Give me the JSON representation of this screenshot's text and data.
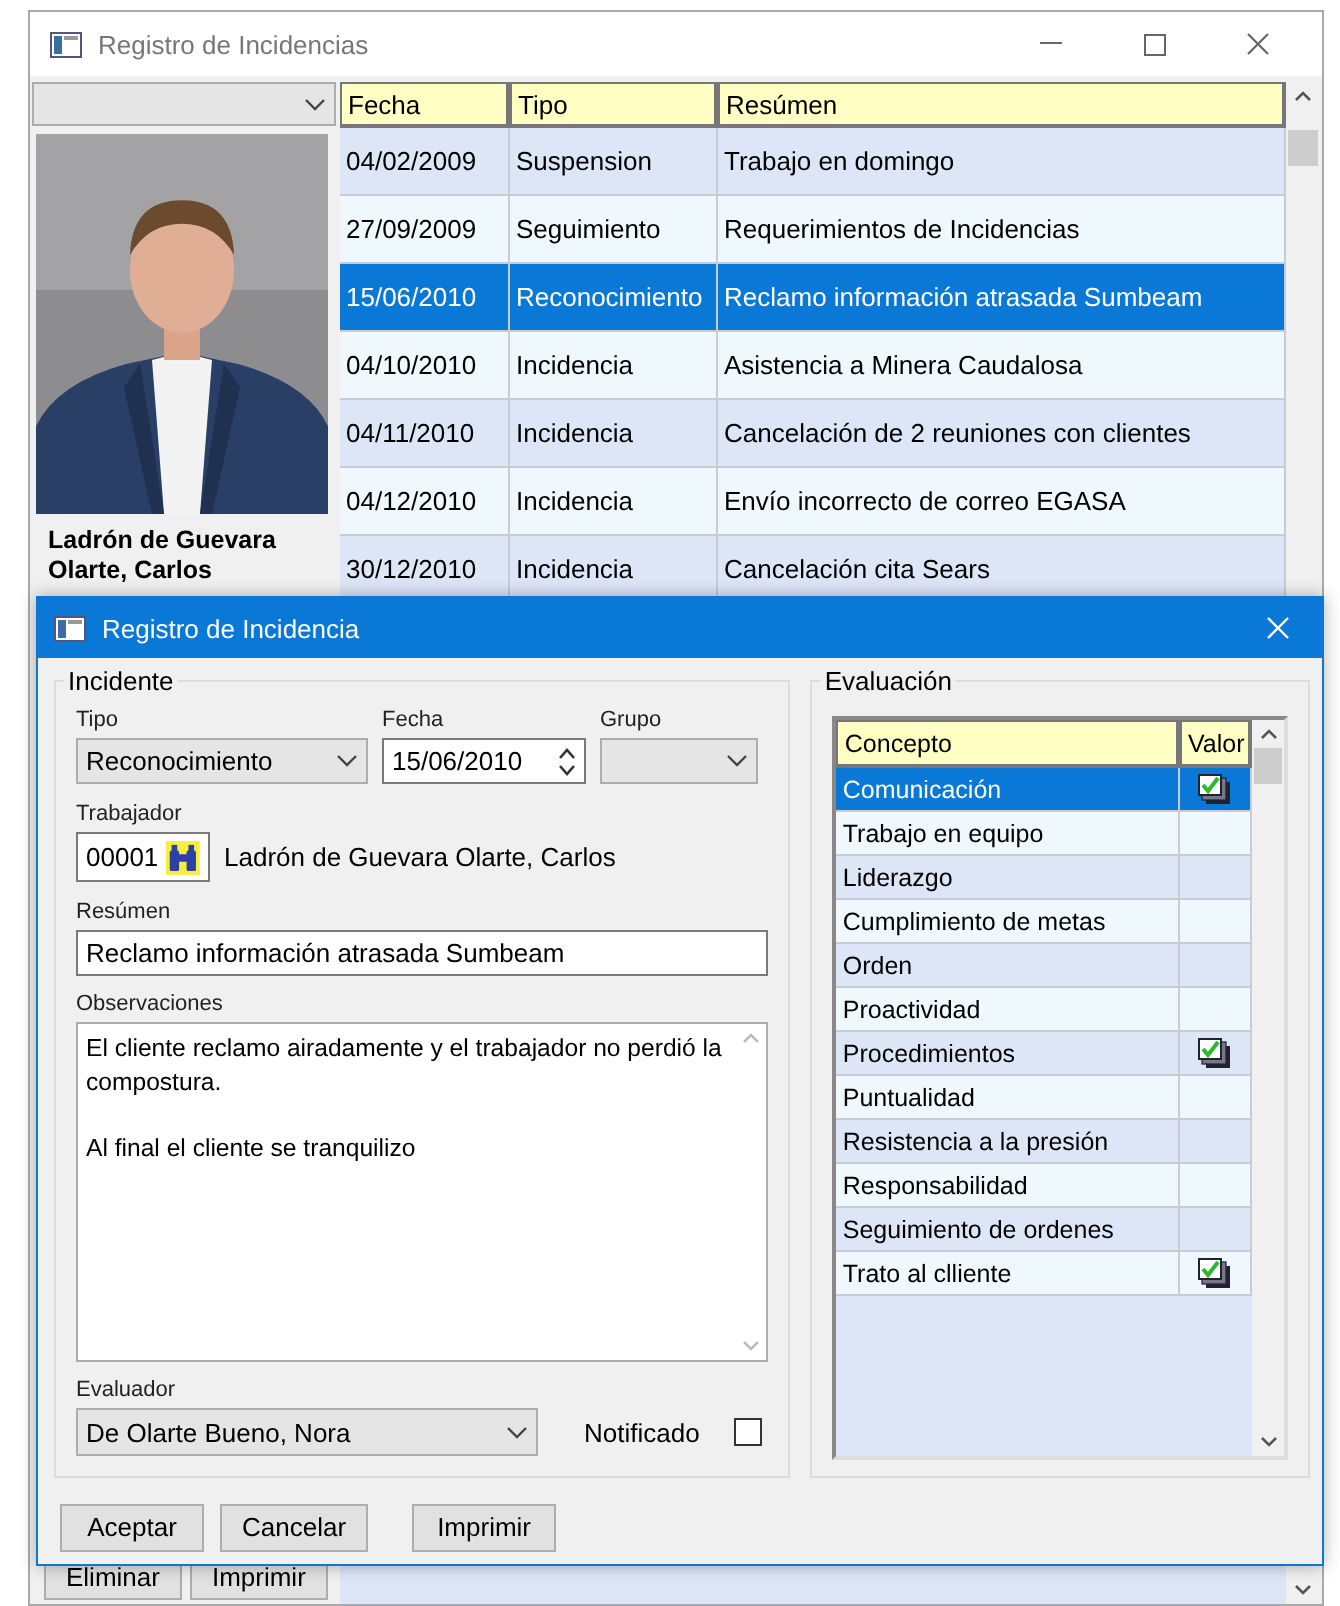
{
  "main_window": {
    "title": "Registro de Incidencias",
    "employee_name": "Ladrón de Guevara Olarte, Carlos",
    "photo": {
      "kind": "picture"
    },
    "table": {
      "columns": [
        "Fecha",
        "Tipo",
        "Resúmen"
      ],
      "rows": [
        {
          "fecha": "04/02/2009",
          "tipo": "Suspension",
          "resumen": "Trabajo en domingo",
          "selected": false
        },
        {
          "fecha": "27/09/2009",
          "tipo": "Seguimiento",
          "resumen": "Requerimientos de Incidencias",
          "selected": false
        },
        {
          "fecha": "15/06/2010",
          "tipo": "Reconocimiento",
          "resumen": "Reclamo información atrasada Sumbeam",
          "selected": true
        },
        {
          "fecha": "04/10/2010",
          "tipo": "Incidencia",
          "resumen": "Asistencia a Minera Caudalosa",
          "selected": false
        },
        {
          "fecha": "04/11/2010",
          "tipo": "Incidencia",
          "resumen": "Cancelación de 2 reuniones con clientes",
          "selected": false
        },
        {
          "fecha": "04/12/2010",
          "tipo": "Incidencia",
          "resumen": "Envío incorrecto de correo EGASA",
          "selected": false
        },
        {
          "fecha": "30/12/2010",
          "tipo": "Incidencia",
          "resumen": "Cancelación cita Sears",
          "selected": false
        }
      ]
    },
    "buttons": [
      "Eliminar",
      "Imprimir"
    ]
  },
  "dialog": {
    "title": "Registro de Incidencia",
    "incidente": {
      "title": "Incidente",
      "tipo": {
        "label": "Tipo",
        "value": "Reconocimiento"
      },
      "fecha": {
        "label": "Fecha",
        "value": "15/06/2010"
      },
      "grupo": {
        "label": "Grupo"
      },
      "trabajador": {
        "label": "Trabajador",
        "code": "00001",
        "name": "Ladrón de Guevara Olarte, Carlos"
      },
      "resumen": {
        "label": "Resúmen",
        "value": "Reclamo información atrasada Sumbeam"
      },
      "observaciones": {
        "label": "Observaciones",
        "paragraphs": [
          "El cliente reclamo airadamente y el trabajador no perdió la compostura.",
          "Al final el cliente se tranquilizo"
        ]
      },
      "evaluador": {
        "label": "Evaluador",
        "value": "De Olarte Bueno, Nora"
      },
      "notificado": {
        "label": "Notificado",
        "checked": false
      }
    },
    "evaluacion": {
      "title": "Evaluación",
      "columns": [
        "Concepto",
        "Valor"
      ],
      "rows": [
        {
          "concepto": "Comunicación",
          "checked": true,
          "selected": true
        },
        {
          "concepto": "Trabajo en equipo",
          "checked": false,
          "selected": false
        },
        {
          "concepto": "Liderazgo",
          "checked": false,
          "selected": false
        },
        {
          "concepto": "Cumplimiento de metas",
          "checked": false,
          "selected": false
        },
        {
          "concepto": "Orden",
          "checked": false,
          "selected": false
        },
        {
          "concepto": "Proactividad",
          "checked": false,
          "selected": false
        },
        {
          "concepto": "Procedimientos",
          "checked": true,
          "selected": false
        },
        {
          "concepto": "Puntualidad",
          "checked": false,
          "selected": false
        },
        {
          "concepto": "Resistencia a la presión",
          "checked": false,
          "selected": false
        },
        {
          "concepto": "Responsabilidad",
          "checked": false,
          "selected": false
        },
        {
          "concepto": "Seguimiento de ordenes",
          "checked": false,
          "selected": false
        },
        {
          "concepto": "Trato al clliente",
          "checked": true,
          "selected": false
        }
      ]
    },
    "buttons": [
      "Aceptar",
      "Cancelar",
      "Imprimir"
    ]
  }
}
